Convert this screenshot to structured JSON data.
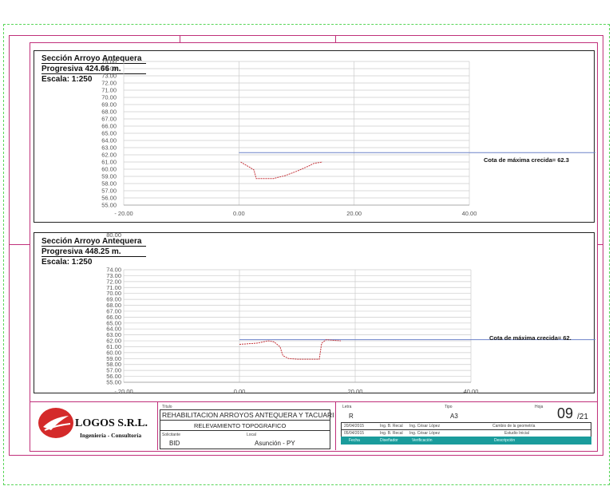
{
  "sections": [
    {
      "id": "top",
      "title": "Sección Arroyo Antequera",
      "progresiva": "Progresiva 424.66 m.",
      "escala": "Escala: 1:250",
      "cota_label": "Cota de máxima crecida= 62.3",
      "chart_data": {
        "type": "line",
        "y_ticks": [
          "75.00",
          "74.00",
          "73.00",
          "72.00",
          "71.00",
          "70.00",
          "69.00",
          "68.00",
          "67.00",
          "66.00",
          "65.00",
          "64.00",
          "63.00",
          "62.00",
          "61.00",
          "60.00",
          "59.00",
          "58.00",
          "57.00",
          "56.00",
          "55.00"
        ],
        "x_ticks": [
          "- 20.00",
          "0.00",
          "20.00",
          "40.00"
        ],
        "ylim": [
          55,
          75
        ],
        "xlim": [
          -20,
          40
        ],
        "flood_level": 62.3,
        "profile": {
          "x": [
            0.3,
            2.0,
            2.6,
            3.0,
            6.0,
            8.0,
            10.0,
            12.0,
            13.0,
            14.5
          ],
          "y": [
            61.0,
            60.2,
            59.9,
            58.7,
            58.7,
            59.1,
            59.7,
            60.4,
            60.8,
            61.0
          ]
        }
      }
    },
    {
      "id": "bottom",
      "title": "Sección Arroyo Antequera",
      "progresiva": "Progresiva 448.25 m.",
      "escala": "Escala: 1:250",
      "extra_tick": "80.00",
      "cota_label": "Cota de máxima crecida= 62.",
      "chart_data": {
        "type": "line",
        "y_ticks": [
          "74.00",
          "73.00",
          "72.00",
          "71.00",
          "70.00",
          "69.00",
          "68.00",
          "67.00",
          "66.00",
          "65.00",
          "64.00",
          "63.00",
          "62.00",
          "61.00",
          "60.00",
          "59.00",
          "58.00",
          "57.00",
          "56.00",
          "55.00"
        ],
        "x_ticks": [
          "- 20.00",
          "0.00",
          "20.00",
          "40.00"
        ],
        "ylim": [
          55,
          74
        ],
        "xlim": [
          -20,
          40
        ],
        "flood_level": 62.2,
        "profile": {
          "x": [
            0.0,
            3.0,
            5.0,
            6.0,
            7.0,
            7.5,
            8.5,
            10.0,
            12.0,
            13.8,
            14.2,
            15.0,
            16.0,
            17.5
          ],
          "y": [
            61.4,
            61.6,
            62.0,
            61.8,
            61.0,
            59.5,
            59.0,
            58.9,
            58.9,
            58.9,
            61.6,
            62.2,
            62.1,
            62.0
          ]
        }
      }
    }
  ],
  "title_block": {
    "company": "LOGOS S.R.L.",
    "company_sub": "Ingeniería - Consultoría",
    "titulo_label": "Título",
    "titulo": "REHABILITACION ARROYOS ANTEQUERA Y TACUARI",
    "subtitulo": "RELEVAMIENTO TOPOGRAFICO",
    "solicitante_label": "Solicitante",
    "solicitante": "BID",
    "local_label": "Local",
    "local": "Asunción - PY",
    "letra_label": "Letra",
    "letra": "R",
    "tipo_label": "Tipo",
    "tipo": "A3",
    "hoja_label": "Hoja",
    "hoja": "09",
    "hoja_total": "/21",
    "revisions": [
      {
        "fecha": "20/04/2015",
        "disenador": "Ing. B. Recal",
        "verificacion": "Ing. César López",
        "descripcion": "Cambio de la geometría"
      },
      {
        "fecha": "05/04/2015",
        "disenador": "Ing. B. Recal",
        "verificacion": "Ing. César López",
        "descripcion": "Estudio Inicial"
      }
    ],
    "rev_headers": {
      "fecha": "Fecha",
      "disenador": "Diseñador",
      "verificacion": "Verificación",
      "descripcion": "Descripción"
    }
  },
  "colors": {
    "frame": "#c0307a",
    "flood_line": "#6d82c9",
    "profile": "#c4343a",
    "grid": "#cccccc",
    "header_bar": "#1a9c9c"
  }
}
